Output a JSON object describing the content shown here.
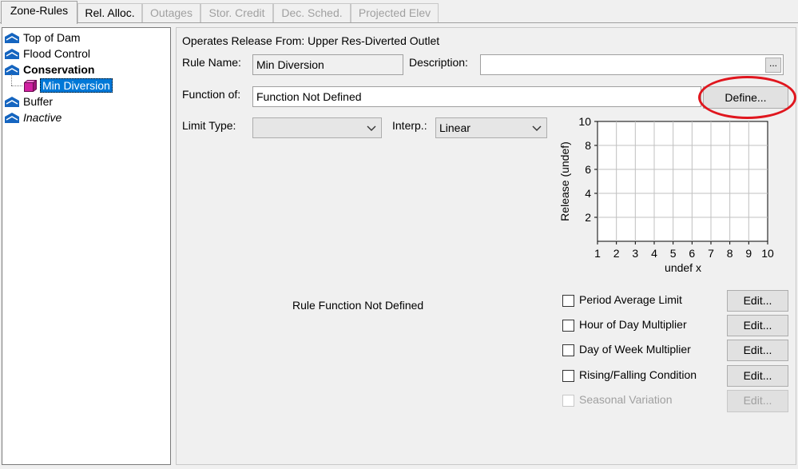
{
  "tabs": [
    {
      "label": "Zone-Rules",
      "state": "active"
    },
    {
      "label": "Rel. Alloc.",
      "state": "enabled"
    },
    {
      "label": "Outages",
      "state": "disabled"
    },
    {
      "label": "Stor. Credit",
      "state": "disabled"
    },
    {
      "label": "Dec. Sched.",
      "state": "disabled"
    },
    {
      "label": "Projected Elev",
      "state": "disabled"
    }
  ],
  "tree": {
    "items": [
      {
        "label": "Top of Dam",
        "icon": "zone-icon"
      },
      {
        "label": "Flood Control",
        "icon": "zone-icon"
      },
      {
        "label": "Conservation",
        "icon": "zone-icon"
      },
      {
        "label": "Min Diversion",
        "icon": "rule-icon"
      },
      {
        "label": "Buffer",
        "icon": "zone-icon"
      },
      {
        "label": "Inactive",
        "icon": "zone-icon"
      }
    ]
  },
  "rule": {
    "operates_release_from": "Operates Release From: Upper Res-Diverted Outlet",
    "rule_name_label": "Rule Name:",
    "rule_name_value": "Min Diversion",
    "description_label": "Description:",
    "description_value": "",
    "description_button": "...",
    "function_of_label": "Function of:",
    "function_of_value": "Function Not Defined",
    "define_button": "Define...",
    "limit_type_label": "Limit Type:",
    "limit_type_value": "",
    "interp_label": "Interp.:",
    "interp_value": "Linear",
    "not_defined_message": "Rule Function Not Defined"
  },
  "chart_data": {
    "type": "line",
    "title": "",
    "xlabel": "undef x",
    "ylabel": "Release (undef)",
    "xlim": [
      1,
      10
    ],
    "ylim": [
      0,
      10
    ],
    "x_ticks": [
      "1",
      "2",
      "3",
      "4",
      "5",
      "6",
      "7",
      "8",
      "9",
      "10"
    ],
    "y_ticks": [
      "10",
      "8",
      "6",
      "4",
      "2"
    ],
    "grid": true,
    "series": []
  },
  "options": [
    {
      "label": "Period Average Limit",
      "checked": false,
      "enabled": true,
      "button": "Edit..."
    },
    {
      "label": "Hour of Day Multiplier",
      "checked": false,
      "enabled": true,
      "button": "Edit..."
    },
    {
      "label": "Day of Week Multiplier",
      "checked": false,
      "enabled": true,
      "button": "Edit..."
    },
    {
      "label": "Rising/Falling Condition",
      "checked": false,
      "enabled": true,
      "button": "Edit..."
    },
    {
      "label": "Seasonal Variation",
      "checked": false,
      "enabled": false,
      "button": "Edit..."
    }
  ],
  "colors": {
    "highlight_annotation": "#e0161e",
    "selection": "#0078d7",
    "zone_icon": "#1565c0",
    "rule_icon": "#d01fa0"
  }
}
